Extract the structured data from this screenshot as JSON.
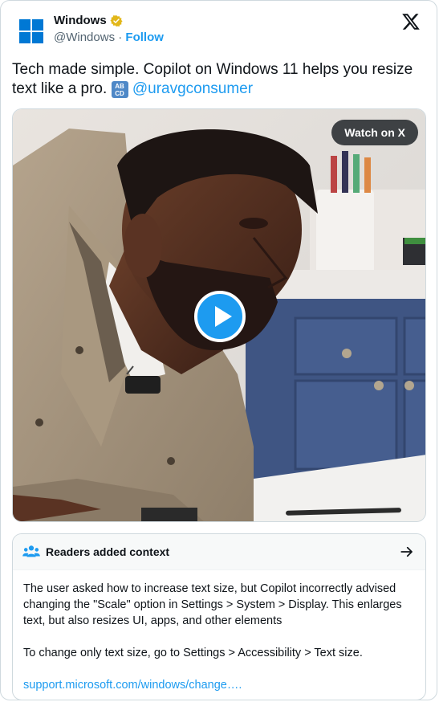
{
  "account": {
    "display_name": "Windows",
    "handle": "@Windows",
    "separator": "·",
    "follow_label": "Follow"
  },
  "icons": {
    "logo": "windows-logo",
    "verified": "verified-gold-badge",
    "brand": "x-logo",
    "play": "play-icon",
    "notes": "people-icon",
    "open": "arrow-right-icon"
  },
  "tweet": {
    "text": "Tech made simple. Copilot on Windows 11 helps you resize text like a pro.",
    "emoji_top": "AB",
    "emoji_bottom": "CD",
    "mention": "@uravgconsumer"
  },
  "media": {
    "watch_label": "Watch on X"
  },
  "notes": {
    "title": "Readers added context",
    "paragraph1": "The user asked how to increase text size, but Copilot incorrectly advised changing the \"Scale\" option in Settings > System > Display. This enlarges text, but also resizes UI, apps, and other elements",
    "paragraph2": "To change only text size, go to Settings > Accessibility > Text size.",
    "link": "support.microsoft.com/windows/change…."
  },
  "colors": {
    "accent": "#1d9bf0",
    "windows_blue": "#0078d4",
    "verified_gold": "#e2b719",
    "text": "#0f1419",
    "muted": "#536471"
  }
}
